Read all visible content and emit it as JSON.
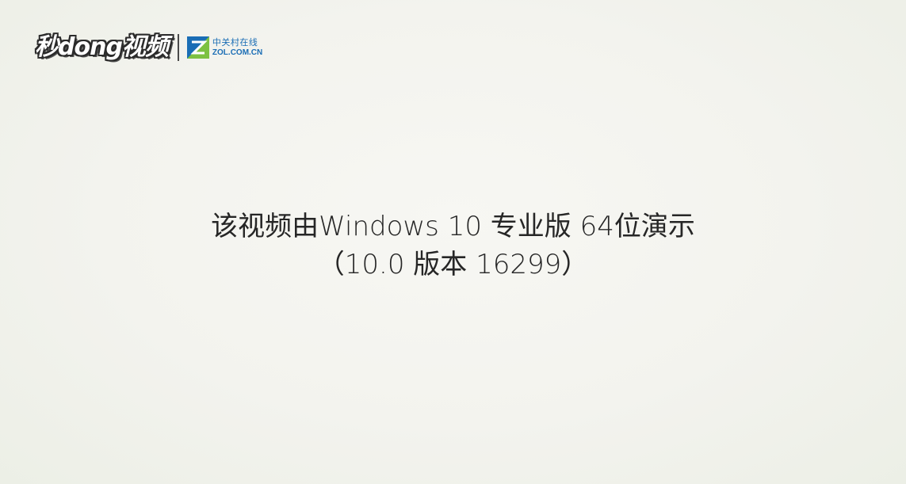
{
  "logos": {
    "miaodong_brand": "秒dong视频",
    "zol_name_cn": "中关村在线",
    "zol_domain": "ZOL.COM.CN"
  },
  "caption": {
    "line1": "该视频由Windows 10 专业版 64位演示",
    "line2": "（10.0 版本 16299）"
  },
  "colors": {
    "background": "#f3f3ee",
    "caption_text": "#262626",
    "zol_blue": "#1a6db5",
    "zol_green": "#7dc142",
    "play_blue": "#2f8fe0"
  },
  "icons": {
    "play": "play-icon",
    "zol": "zol-logo-icon"
  }
}
